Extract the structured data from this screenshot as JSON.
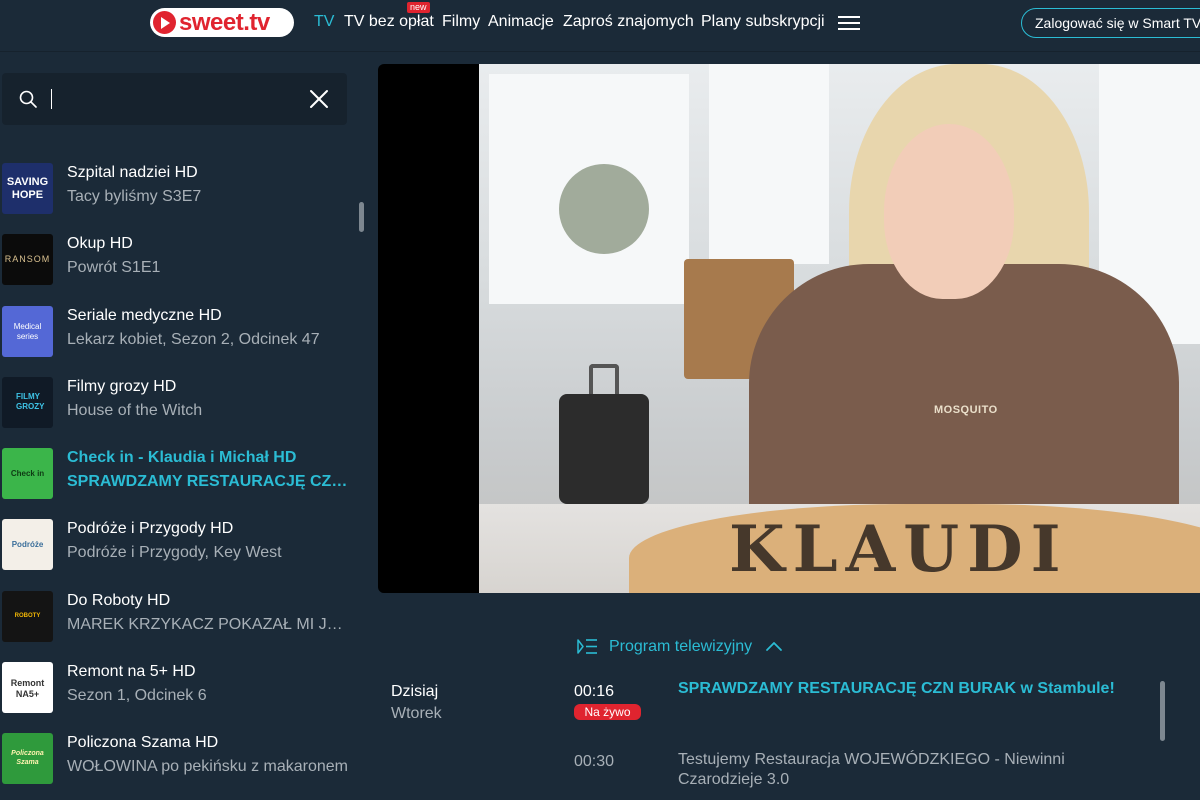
{
  "header": {
    "logo_text": "sweet.tv",
    "nav": [
      {
        "label": "TV",
        "active": true
      },
      {
        "label": "TV bez opłat",
        "badge": "new"
      },
      {
        "label": "Filmy"
      },
      {
        "label": "Animacje"
      },
      {
        "label": "Zaproś znajomych"
      },
      {
        "label": "Plany subskrypcji"
      }
    ],
    "menu_icon": "hamburger-icon",
    "login_label": "Zalogować się w Smart TV"
  },
  "sidebar": {
    "search": {
      "value": "",
      "placeholder": ""
    },
    "channels": [
      {
        "title": "Szpital nadziei HD",
        "subtitle": "Tacy byliśmy S3E7",
        "logo_text": "SAVING HOPE",
        "logo_bg": "#1e2f6b"
      },
      {
        "title": "Okup HD",
        "subtitle": "Powrót S1E1",
        "logo_text": "RANSOM",
        "logo_bg": "#0b0b0b"
      },
      {
        "title": "Seriale medyczne HD",
        "subtitle": "Lekarz kobiet, Sezon 2, Odcinek 47",
        "logo_text": "Medical series",
        "logo_bg": "#5468d6"
      },
      {
        "title": "Filmy grozy HD",
        "subtitle": "House of the Witch",
        "logo_text": "FILMY GROZY",
        "logo_bg": "#101a26"
      },
      {
        "title": "Check in - Klaudia i Michał HD",
        "subtitle": "SPRAWDZAMY RESTAURACJĘ CZN BURAK w Stambule!",
        "logo_text": "Check in",
        "logo_bg": "#3bb54a",
        "active": true
      },
      {
        "title": "Podróże i Przygody HD",
        "subtitle": "Podróże i Przygody, Key West",
        "logo_text": "Podróże",
        "logo_bg": "#f3efe8"
      },
      {
        "title": "Do Roboty HD",
        "subtitle": "MAREK KRZYKACZ POKAZAŁ MI JAK WYGLĄDA JEGO PRACA",
        "logo_text": "ROBOTY",
        "logo_bg": "#141414"
      },
      {
        "title": "Remont na 5+ HD",
        "subtitle": "Sezon 1, Odcinek 6",
        "logo_text": "Remont NA5+",
        "logo_bg": "#ffffff"
      },
      {
        "title": "Policzona Szama HD",
        "subtitle": "WOŁOWINA po pekińsku z makaronem",
        "logo_text": "Policzona Szama",
        "logo_bg": "#2f9a3c"
      }
    ]
  },
  "player": {
    "shirt_text": "MOSQUITO",
    "overlay_text": "KLAUDI"
  },
  "epg": {
    "toggle_label": "Program telewizyjny",
    "day": "Dzisiaj",
    "weekday": "Wtorek",
    "live_label": "Na żywo",
    "items": [
      {
        "time": "00:16",
        "title": "SPRAWDZAMY RESTAURACJĘ CZN BURAK w Stambule!"
      },
      {
        "time": "00:30",
        "title": "Testujemy Restauracja WOJEWÓDZKIEGO - Niewinni Czarodzieje 3.0"
      }
    ]
  },
  "colors": {
    "accent": "#2bbcd4",
    "brand_red": "#e0242f",
    "background": "#1b2a38"
  }
}
